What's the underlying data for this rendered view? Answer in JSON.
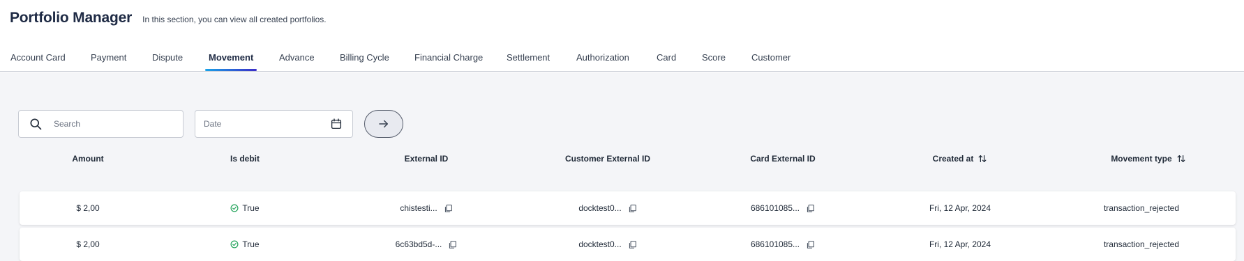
{
  "header": {
    "title": "Portfolio Manager",
    "subtitle": "In this section, you can view all created portfolios."
  },
  "tabs": [
    {
      "label": "Account Card"
    },
    {
      "label": "Payment"
    },
    {
      "label": "Dispute"
    },
    {
      "label": "Movement",
      "active": true
    },
    {
      "label": "Advance"
    },
    {
      "label": "Billing Cycle"
    },
    {
      "label": "Financial Charge"
    },
    {
      "label": "Settlement"
    },
    {
      "label": "Authorization"
    },
    {
      "label": "Card"
    },
    {
      "label": "Score"
    },
    {
      "label": "Customer"
    }
  ],
  "filters": {
    "search_placeholder": "Search",
    "date_placeholder": "Date",
    "icons": {
      "search": "search-icon",
      "date": "calendar-icon",
      "submit": "arrow-right-icon"
    }
  },
  "table": {
    "columns": [
      "Amount",
      "Is debit",
      "External ID",
      "Customer External ID",
      "Card External ID",
      "Created at",
      "Movement type"
    ],
    "rows": [
      {
        "amount": "$ 2,00",
        "is_debit": "True",
        "external_id": "chistesti...",
        "customer_external_id": "docktest0...",
        "card_external_id": "686101085...",
        "created_at": "Fri, 12 Apr, 2024",
        "movement_type": "transaction_rejected"
      },
      {
        "amount": "$ 2,00",
        "is_debit": "True",
        "external_id": "6c63bd5d-...",
        "customer_external_id": "docktest0...",
        "card_external_id": "686101085...",
        "created_at": "Fri, 12 Apr, 2024",
        "movement_type": "transaction_rejected"
      }
    ]
  },
  "colors": {
    "accent_gradient_start": "#1aa3e8",
    "accent_gradient_end": "#3b2dc8",
    "success": "#22a35a",
    "background": "#f4f5f8"
  }
}
